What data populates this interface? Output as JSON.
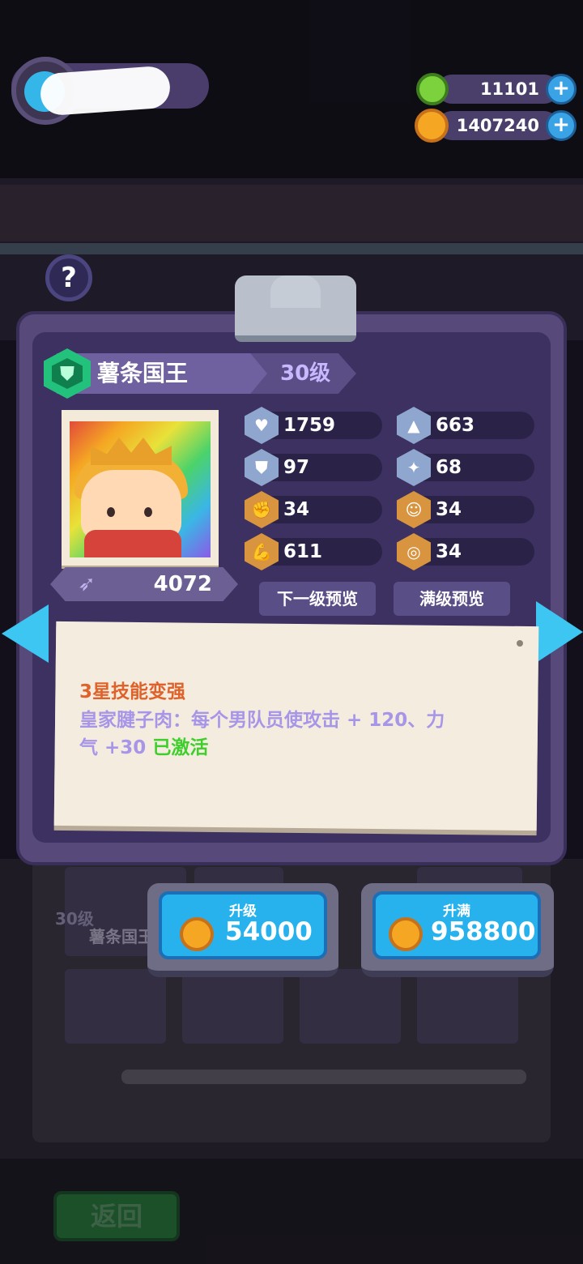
{
  "currencies": {
    "gems": "11101",
    "coins": "1407240",
    "plus_symbol": "+"
  },
  "help": {
    "symbol": "?"
  },
  "hero": {
    "name": "薯条国王",
    "level": "30级",
    "power": "4072"
  },
  "stats": [
    {
      "icon": "heart-icon",
      "value": "1759"
    },
    {
      "icon": "attack-icon",
      "value": "663"
    },
    {
      "icon": "shield-icon",
      "value": "97"
    },
    {
      "icon": "crit-icon",
      "value": "68"
    },
    {
      "icon": "strength-icon",
      "value": "34"
    },
    {
      "icon": "charm-icon",
      "value": "34"
    },
    {
      "icon": "muscle-icon",
      "value": "611"
    },
    {
      "icon": "brain-icon",
      "value": "34"
    }
  ],
  "preview_buttons": {
    "next_level": "下一级预览",
    "max_level": "满级预览"
  },
  "skill_note": {
    "title": "3星技能变强",
    "description": "皇家腱子肉：每个男队员使攻击 + 120、力气 +30",
    "status": "已激活"
  },
  "background_card": {
    "level": "30级",
    "name": "薯条国王"
  },
  "upgrade": {
    "upgrade_label": "升级",
    "upgrade_cost": "54000",
    "max_label": "升满",
    "max_cost": "958800"
  },
  "back_button": "返回",
  "colors": {
    "panel": "#574a7a",
    "accent_blue": "#27b2ee",
    "note_title": "#e0622b",
    "note_text": "#a795e8",
    "active_green": "#3ecf2c"
  }
}
